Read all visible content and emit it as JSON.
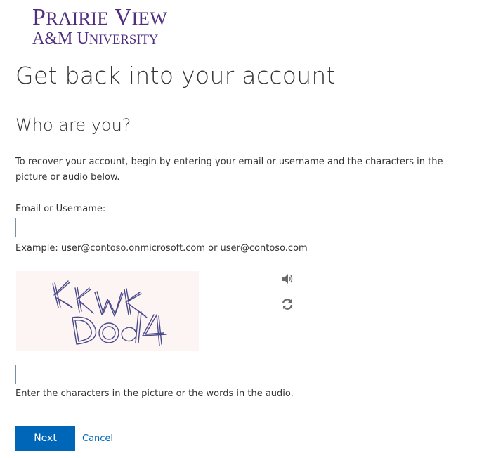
{
  "logo": {
    "line1_cap1": "P",
    "line1_rest1": "RAIRIE",
    "line1_cap2": "V",
    "line1_rest2": "IEW",
    "line2_cap1": "A&M",
    "line2_cap2": "U",
    "line2_rest2": "NIVERSITY",
    "color": "#4f2d7f"
  },
  "page": {
    "title": "Get back into your account",
    "subtitle": "Who are you?",
    "instructions": "To recover your account, begin by entering your email or username and the characters in the picture or audio below."
  },
  "email": {
    "label": "Email or Username:",
    "value": "",
    "hint": "Example: user@contoso.onmicrosoft.com or user@contoso.com"
  },
  "captcha": {
    "image_text": "KKWK D0d4",
    "audio_icon": "speaker-icon",
    "refresh_icon": "refresh-icon",
    "value": "",
    "hint": "Enter the characters in the picture or the words in the audio."
  },
  "actions": {
    "next_label": "Next",
    "cancel_label": "Cancel"
  },
  "colors": {
    "primary": "#0067b8",
    "text": "#333333"
  }
}
